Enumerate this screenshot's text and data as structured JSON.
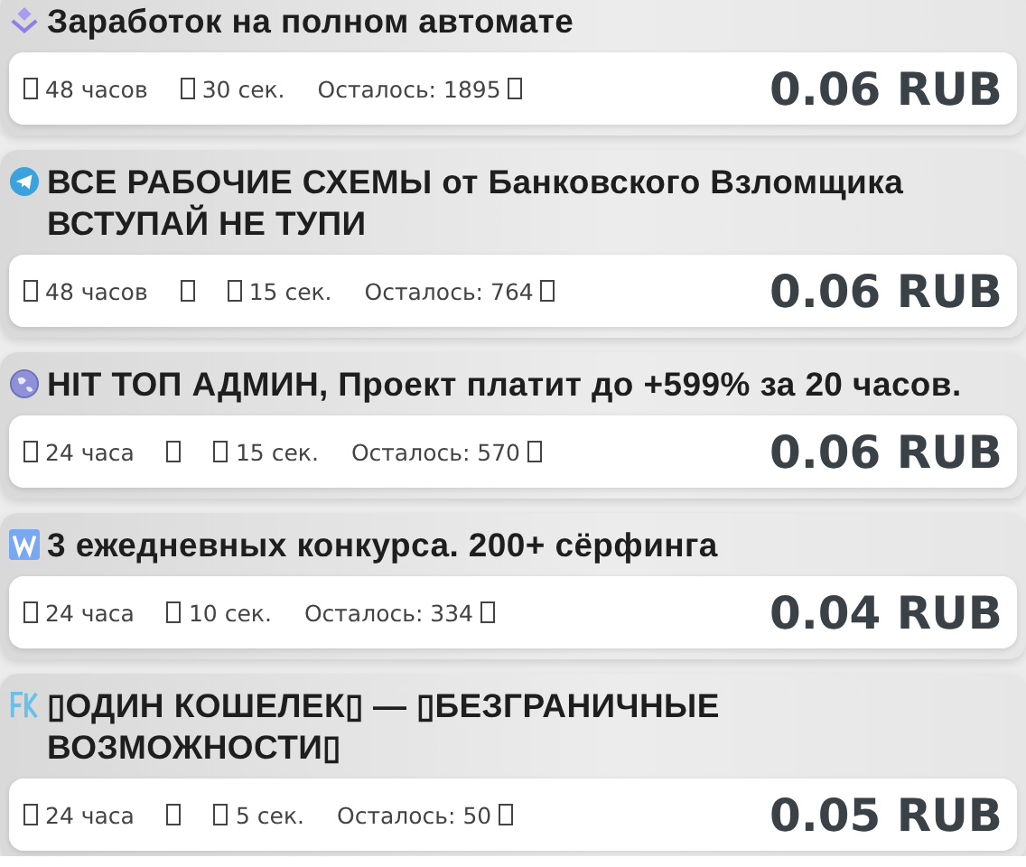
{
  "tasks": [
    {
      "title": "Заработок на полном автомате",
      "meta": [
        {
          "kind": "icon-text",
          "text": "48 часов"
        },
        {
          "kind": "icon-text",
          "text": "30 сек."
        },
        {
          "kind": "text-icon",
          "text": "Осталось: 1895"
        }
      ],
      "price": "0.06 RUB"
    },
    {
      "title": "ВСЕ РАБОЧИЕ СХЕМЫ от Банковского Взломщика ВСТУПАЙ НЕ ТУПИ",
      "meta": [
        {
          "kind": "icon-text",
          "text": "48 часов"
        },
        {
          "kind": "icon"
        },
        {
          "kind": "icon-text",
          "text": "15 сек."
        },
        {
          "kind": "text-icon",
          "text": "Осталось: 764"
        }
      ],
      "price": "0.06 RUB"
    },
    {
      "title": "HIT ТОП АДМИН, Проект платит до +599% за 20 часов.",
      "meta": [
        {
          "kind": "icon-text",
          "text": "24 часа"
        },
        {
          "kind": "icon"
        },
        {
          "kind": "icon-text",
          "text": "15 сек."
        },
        {
          "kind": "text-icon",
          "text": "Осталось: 570"
        }
      ],
      "price": "0.06 RUB"
    },
    {
      "title": "3 ежедневных конкурса. 200+ сёрфинга",
      "meta": [
        {
          "kind": "icon-text",
          "text": "24 часа"
        },
        {
          "kind": "icon-text",
          "text": "10 сек."
        },
        {
          "kind": "text-icon",
          "text": "Осталось: 334"
        }
      ],
      "price": "0.04 RUB"
    },
    {
      "title": "▯ОДИН КОШЕЛЕК▯ — ▯БЕЗГРАНИЧНЫЕ ВОЗМОЖНОСТИ▯",
      "meta": [
        {
          "kind": "icon-text",
          "text": "24 часа"
        },
        {
          "kind": "icon"
        },
        {
          "kind": "icon-text",
          "text": "5 сек."
        },
        {
          "kind": "text-icon",
          "text": "Осталось: 50"
        }
      ],
      "price": "0.05 RUB"
    }
  ]
}
